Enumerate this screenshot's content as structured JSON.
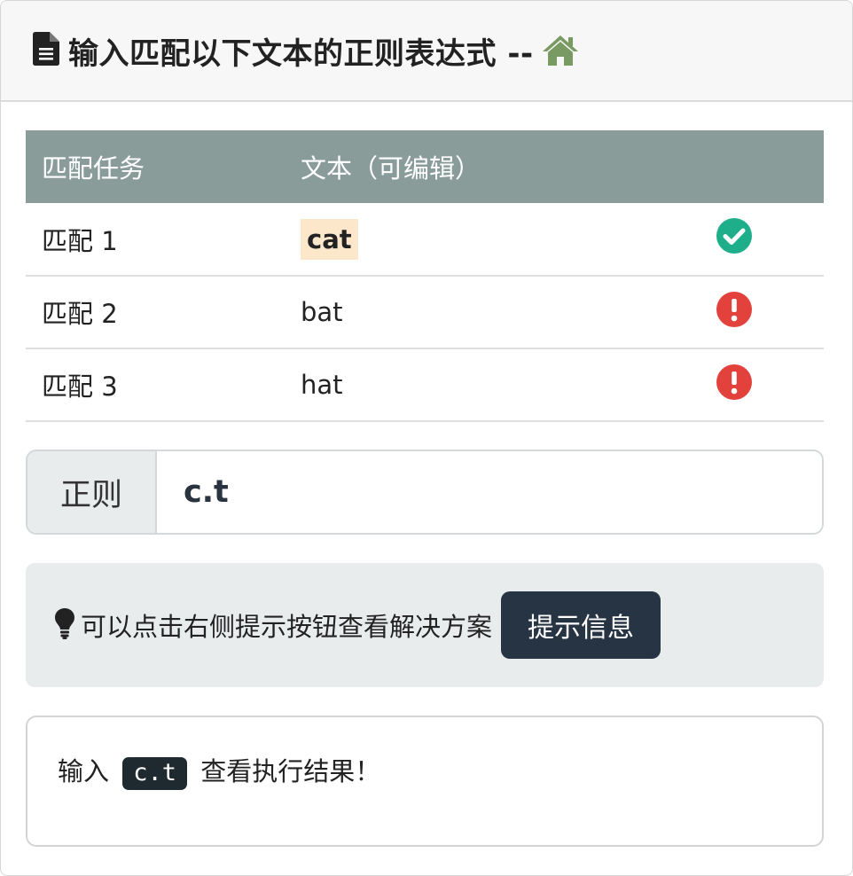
{
  "header": {
    "title": "输入匹配以下文本的正则表达式 --",
    "doc_icon": "document-icon",
    "home_icon": "home-icon",
    "home_color": "#7a9a63"
  },
  "table": {
    "headers": [
      "匹配任务",
      "文本（可编辑）"
    ],
    "rows": [
      {
        "task": "匹配 1",
        "text": "cat",
        "status": "matched",
        "status_icon": "check-circle-icon",
        "status_color": "#1fae8a"
      },
      {
        "task": "匹配 2",
        "text": "bat",
        "status": "not-matched",
        "status_icon": "exclamation-circle-icon",
        "status_color": "#e2423b"
      },
      {
        "task": "匹配 3",
        "text": "hat",
        "status": "not-matched",
        "status_icon": "exclamation-circle-icon",
        "status_color": "#e2423b"
      }
    ],
    "header_color": "#899c9a",
    "highlight_color": "#fde7cb"
  },
  "regex": {
    "label": "正则",
    "value": "c.t"
  },
  "hint": {
    "icon": "lightbulb-icon",
    "text": "可以点击右侧提示按钮查看解决方案",
    "button_label": "提示信息"
  },
  "result": {
    "prefix": "输入",
    "code": "c.t",
    "suffix": "查看执行结果！"
  }
}
